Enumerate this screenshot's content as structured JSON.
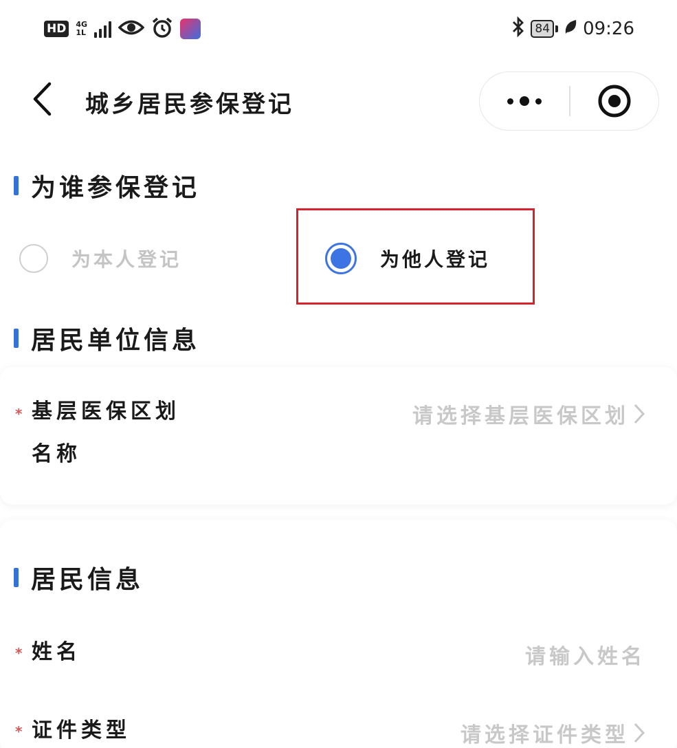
{
  "status_bar": {
    "hd": "HD",
    "network_top": "4G",
    "network_bottom": "1L",
    "battery": "84",
    "time": "09:26"
  },
  "nav": {
    "title": "城乡居民参保登记"
  },
  "section_who": {
    "title": "为谁参保登记",
    "options": [
      {
        "label": "为本人登记",
        "selected": false
      },
      {
        "label": "为他人登记",
        "selected": true
      }
    ]
  },
  "section_unit": {
    "title": "居民单位信息",
    "rows": [
      {
        "label_line1": "基层医保区划",
        "label_line2": "名称",
        "placeholder": "请选择基层医保区划",
        "required": "*"
      }
    ]
  },
  "section_resident": {
    "title": "居民信息",
    "rows": [
      {
        "label": "姓名",
        "placeholder": "请输入姓名",
        "required": "*"
      },
      {
        "label": "证件类型",
        "placeholder": "请选择证件类型",
        "required": "*"
      }
    ]
  },
  "colors": {
    "accent": "#3471d8",
    "radio_selected": "#3d74e3",
    "required": "#d95757",
    "placeholder": "#c8c8c8",
    "highlight_box": "#d4232c"
  },
  "icons": {
    "back": "chevron-left-icon",
    "more": "more-dots-icon",
    "close": "target-close-icon",
    "bluetooth": "bluetooth-icon",
    "eye": "eye-icon",
    "alarm": "alarm-icon",
    "leaf": "leaf-icon",
    "chevron_right": "chevron-right-icon"
  }
}
